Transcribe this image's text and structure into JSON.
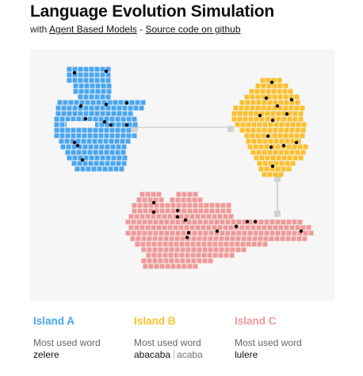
{
  "header": {
    "title": "Language Evolution Simulation",
    "subtitle_prefix": "with ",
    "link_models": "Agent Based Models",
    "subtitle_sep": " - ",
    "link_source": "Source code on github"
  },
  "colors": {
    "background": "#f6f6f6",
    "bridge": "#d3d3d3",
    "agent": "#000000",
    "island_a": "#4aa6f0",
    "island_b": "#fbc02d",
    "island_c": "#ef9a9a"
  },
  "islands": [
    {
      "id": "a",
      "name": "Island A",
      "color": "#4aa6f0",
      "label": "Most used word",
      "word": "zelere",
      "alt_word": ""
    },
    {
      "id": "b",
      "name": "Island B",
      "color": "#fbc02d",
      "label": "Most used word",
      "word": "abacaba",
      "alt_word": "acaba"
    },
    {
      "id": "c",
      "name": "Island C",
      "color": "#ef9a9a",
      "label": "Most used word",
      "word": "lulere",
      "alt_word": ""
    }
  ]
}
